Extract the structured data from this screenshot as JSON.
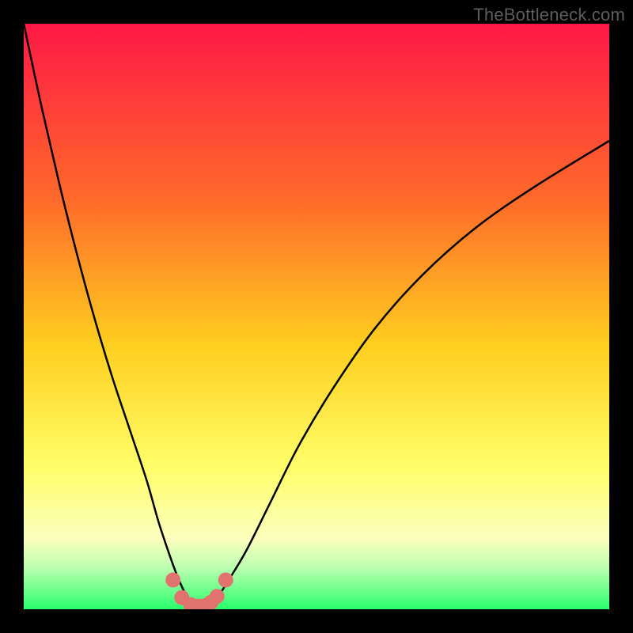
{
  "watermark": "TheBottleneck.com",
  "colors": {
    "frame": "#000000",
    "grad_top": "#ff1846",
    "grad_mid1": "#ff6a2a",
    "grad_mid2": "#ffcf1f",
    "grad_yellow": "#ffff6a",
    "grad_pale": "#fbffbd",
    "grad_green_top": "#baffb0",
    "grad_green": "#29ff6d",
    "curve": "#000000",
    "marker_fill": "#e0736d",
    "marker_stroke": "#b94f49"
  },
  "chart_data": {
    "type": "line",
    "title": "",
    "xlabel": "",
    "ylabel": "",
    "xlim": [
      0,
      100
    ],
    "ylim": [
      0,
      100
    ],
    "series": [
      {
        "name": "bottleneck-curve",
        "x": [
          0,
          3,
          6,
          9,
          12,
          15,
          18,
          21,
          23,
          25,
          26.5,
          28,
          29.5,
          31,
          33,
          35,
          38,
          42,
          47,
          53,
          60,
          68,
          77,
          87,
          100
        ],
        "y": [
          100,
          86,
          73,
          61,
          50,
          40,
          31,
          22,
          15,
          9,
          5,
          2,
          0.5,
          0.5,
          2,
          5,
          10,
          18,
          28,
          38,
          48,
          57,
          65,
          72,
          80
        ]
      }
    ],
    "markers": {
      "name": "highlight-cluster",
      "x": [
        25.5,
        27,
        28.5,
        29.5,
        30,
        31,
        32,
        33,
        34.5
      ],
      "y": [
        5,
        2,
        0.8,
        0.5,
        0.5,
        0.6,
        1.2,
        2.2,
        5
      ]
    },
    "gradient_stops": [
      {
        "pos": 0.0,
        "key": "grad_top"
      },
      {
        "pos": 0.3,
        "key": "grad_mid1"
      },
      {
        "pos": 0.55,
        "key": "grad_mid2"
      },
      {
        "pos": 0.76,
        "key": "grad_yellow"
      },
      {
        "pos": 0.88,
        "key": "grad_pale"
      },
      {
        "pos": 0.93,
        "key": "grad_green_top"
      },
      {
        "pos": 1.0,
        "key": "grad_green"
      }
    ]
  }
}
